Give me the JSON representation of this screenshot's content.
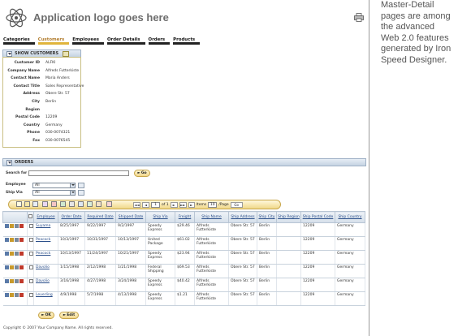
{
  "app": {
    "logo_text": "Application logo goes here"
  },
  "side_note": [
    "Master-Detail",
    "pages are among",
    "the advanced",
    "Web 2.0 features",
    "generated by Iron",
    "Speed Designer."
  ],
  "nav": [
    {
      "label": "Categories",
      "active": false
    },
    {
      "label": "Customers",
      "active": true
    },
    {
      "label": "Employees",
      "active": false
    },
    {
      "label": "Order Details",
      "active": false
    },
    {
      "label": "Orders",
      "active": false
    },
    {
      "label": "Products",
      "active": false
    }
  ],
  "customer_panel": {
    "title": "SHOW CUSTOMERS",
    "fields": [
      {
        "label": "Customer ID",
        "value": "ALFKI"
      },
      {
        "label": "Company Name",
        "value": "Alfreds Futterkiste"
      },
      {
        "label": "Contact Name",
        "value": "Maria Anders"
      },
      {
        "label": "Contact Title",
        "value": "Sales Representative"
      },
      {
        "label": "Address",
        "value": "Obere Str. 57"
      },
      {
        "label": "City",
        "value": "Berlin"
      },
      {
        "label": "Region",
        "value": ""
      },
      {
        "label": "Postal Code",
        "value": "12209"
      },
      {
        "label": "Country",
        "value": "Germany"
      },
      {
        "label": "Phone",
        "value": "030-0074321"
      },
      {
        "label": "Fax",
        "value": "030-0076545"
      }
    ]
  },
  "orders_panel": {
    "title": "ORDERS",
    "search_label": "Search for",
    "go_label": "Go",
    "employee_label": "Employee",
    "employee_value": "All",
    "shipvia_label": "Ship Via",
    "shipvia_value": "All",
    "pager": {
      "page_value": "1",
      "of_text": "of 1",
      "items_label": "Items",
      "items_value": "10",
      "per_page": "/Page",
      "go_label": "Go"
    },
    "columns": [
      "Employee",
      "Order Date",
      "Required Date",
      "Shipped Date",
      "Ship Via",
      "Freight",
      "Ship Name",
      "Ship Address",
      "Ship City",
      "Ship Region",
      "Ship Postal Code",
      "Ship Country"
    ],
    "rows": [
      [
        "Suyama",
        "8/25/1997",
        "9/22/1997",
        "9/2/1997",
        "Speedy Express",
        "$29.46",
        "Alfreds Futterkiste",
        "Obere Str. 57",
        "Berlin",
        "",
        "12209",
        "Germany"
      ],
      [
        "Peacock",
        "10/3/1997",
        "10/31/1997",
        "10/13/1997",
        "United Package",
        "$61.02",
        "Alfreds Futterkiste",
        "Obere Str. 57",
        "Berlin",
        "",
        "12209",
        "Germany"
      ],
      [
        "Peacock",
        "10/13/1997",
        "11/24/1997",
        "10/21/1997",
        "Speedy Express",
        "$23.94",
        "Alfreds Futterkiste",
        "Obere Str. 57",
        "Berlin",
        "",
        "12209",
        "Germany"
      ],
      [
        "Davolio",
        "1/15/1998",
        "2/12/1998",
        "1/21/1998",
        "Federal Shipping",
        "$69.53",
        "Alfreds Futterkiste",
        "Obere Str. 57",
        "Berlin",
        "",
        "12209",
        "Germany"
      ],
      [
        "Davolio",
        "3/16/1998",
        "4/27/1998",
        "3/24/1998",
        "Speedy Express",
        "$40.42",
        "Alfreds Futterkiste",
        "Obere Str. 57",
        "Berlin",
        "",
        "12209",
        "Germany"
      ],
      [
        "Leverling",
        "4/9/1998",
        "5/7/1998",
        "4/13/1998",
        "Speedy Express",
        "$1.21",
        "Alfreds Futterkiste",
        "Obere Str. 57",
        "Berlin",
        "",
        "12209",
        "Germany"
      ]
    ]
  },
  "footer": {
    "ok_label": "OK",
    "edit_label": "Edit",
    "copyright": "Copyright © 2007 Your Company Name. All rights reserved."
  }
}
